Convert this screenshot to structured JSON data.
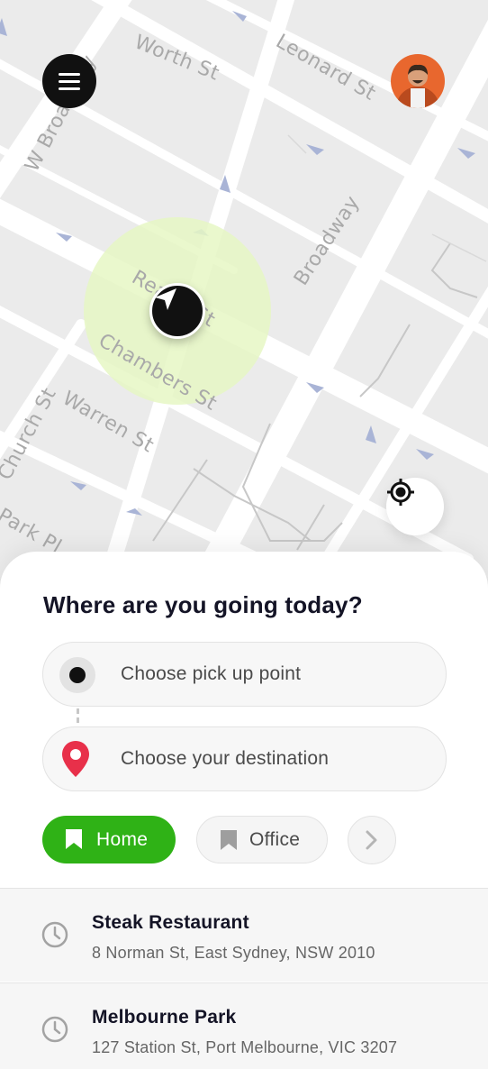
{
  "map": {
    "streets": [
      "Worth St",
      "Leonard St",
      "W Broadway",
      "Broadway",
      "Chambers St",
      "Reade St",
      "Warren St",
      "Church St",
      "Park Pl"
    ]
  },
  "header": {
    "menu_icon": "hamburger-menu-icon",
    "avatar_icon": "user-avatar"
  },
  "location": {
    "marker_icon": "navigation-arrow-icon",
    "locate_icon": "crosshair-locate-icon",
    "radius_color": "#e6f7c4"
  },
  "sheet": {
    "title": "Where are you going today?",
    "pickup_placeholder": "Choose pick up point",
    "destination_placeholder": "Choose your destination",
    "chips": [
      {
        "label": "Home",
        "icon": "bookmark-icon",
        "active": true
      },
      {
        "label": "Office",
        "icon": "bookmark-icon",
        "active": false
      }
    ],
    "more_icon": "chevron-right-icon",
    "recent": [
      {
        "name": "Steak Restaurant",
        "address": "8 Norman St, East Sydney, NSW 2010",
        "icon": "clock-icon"
      },
      {
        "name": "Melbourne Park",
        "address": "127 Station St, Port Melbourne, VIC 3207",
        "icon": "clock-icon"
      }
    ]
  },
  "colors": {
    "accent": "#2fb216",
    "pin": "#e8304a",
    "dark": "#111111"
  }
}
